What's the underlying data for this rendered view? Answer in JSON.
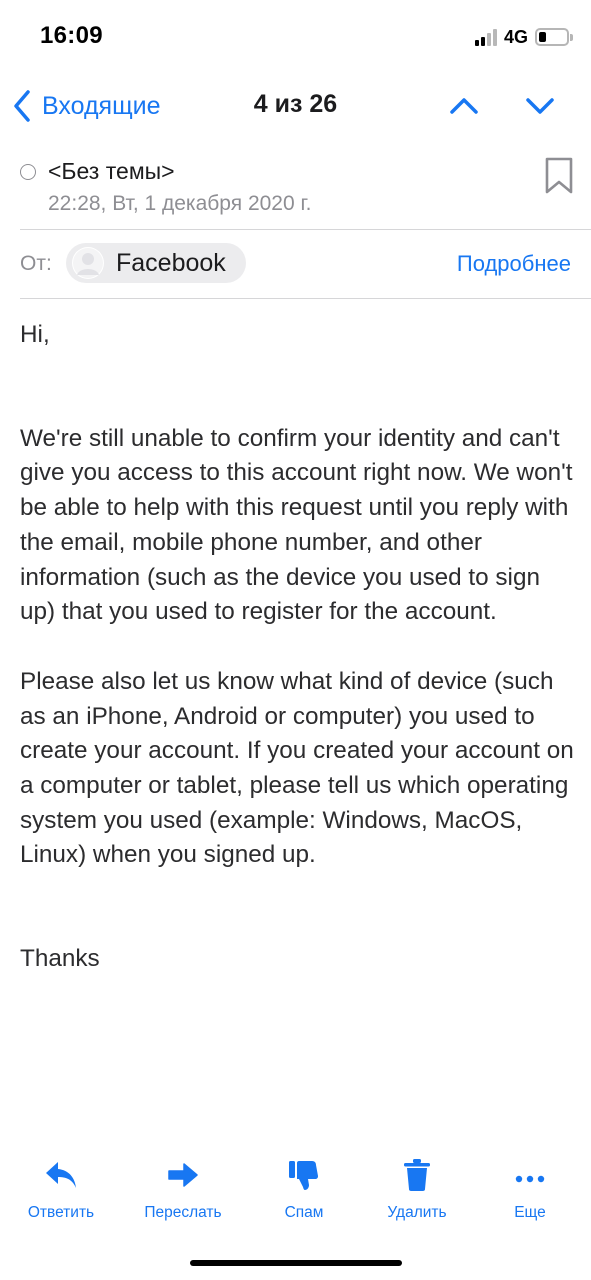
{
  "status_bar": {
    "time": "16:09",
    "network": "4G",
    "battery_level": 0.25
  },
  "nav": {
    "back_label": "Входящие",
    "position": "4 из 26"
  },
  "message": {
    "subject": "<Без темы>",
    "date": "22:28, Вт, 1 декабря 2020 г.",
    "from_label": "От:",
    "sender": "Facebook",
    "details_label": "Подробнее",
    "body": {
      "greeting": "Hi,",
      "paragraph1": "We're still unable to confirm your identity and can't give you access to this account right now. We won't be able to help with this request until you reply with the email, mobile phone number, and other information (such as the device you used to sign up) that you used to register for the account.",
      "paragraph2": "Please also let us know what kind of device (such as an iPhone, Android or computer) you used to create your account. If you created your account on a computer or tablet, please tell us which operating system you used (example: Windows, MacOS, Linux) when you signed up.",
      "closing": "Thanks"
    }
  },
  "toolbar": {
    "reply": "Ответить",
    "forward": "Переслать",
    "spam": "Спам",
    "delete": "Удалить",
    "more": "Еще"
  },
  "colors": {
    "accent": "#1877f2",
    "secondary_text": "#8e8e93",
    "chip_background": "#ececee"
  },
  "icons": [
    "chevron-left-icon",
    "chevron-up-icon",
    "chevron-down-icon",
    "bookmark-icon",
    "reply-icon",
    "forward-icon",
    "thumbs-down-icon",
    "trash-icon",
    "more-icon"
  ]
}
